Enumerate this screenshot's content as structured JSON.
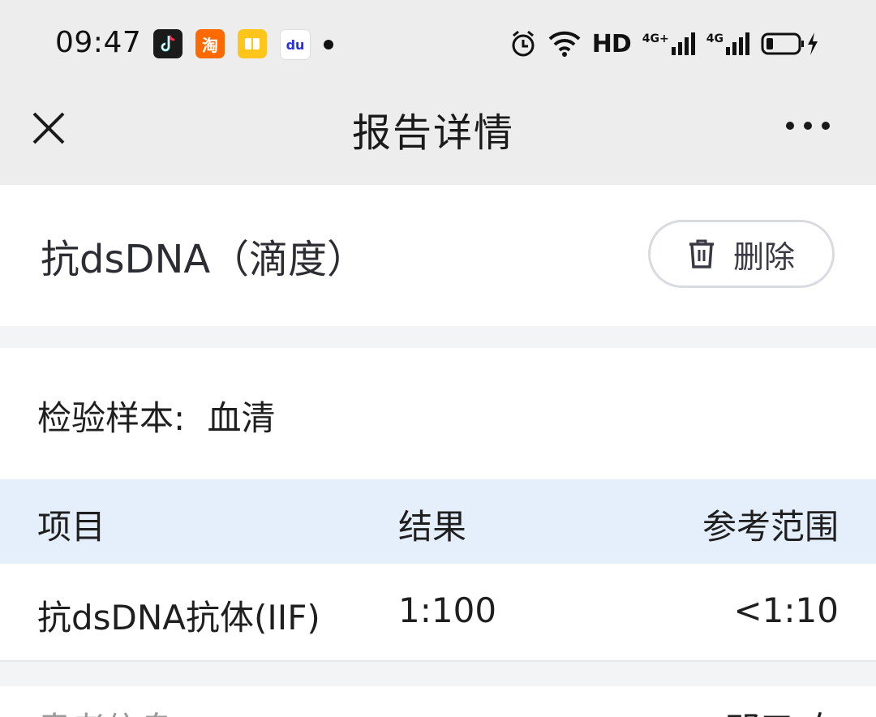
{
  "status_bar": {
    "time": "09:47",
    "icons": [
      "tiktok-icon",
      "taobao-icon",
      "reader-icon",
      "baidu-icon"
    ],
    "taobao_glyph": "淘",
    "baidu_glyph": "du",
    "hd_label": "HD",
    "net_labels": [
      "4G+",
      "4G"
    ]
  },
  "nav": {
    "title": "报告详情"
  },
  "report": {
    "title": "抗dsDNA（滴度）",
    "delete_label": "删除"
  },
  "sample": {
    "label": "检验样本:",
    "value": "血清"
  },
  "table": {
    "headers": [
      "项目",
      "结果",
      "参考范围"
    ],
    "rows": [
      {
        "item": "抗dsDNA抗体(IIF)",
        "result": "1:100",
        "range": "<1:10"
      }
    ]
  },
  "next_section": {
    "left_cut": "患者信息",
    "right_cut": "邓三 女"
  },
  "colors": {
    "header_bg": "#ededed",
    "table_header_bg": "#e5effb",
    "page_bg": "#f3f4f6"
  }
}
